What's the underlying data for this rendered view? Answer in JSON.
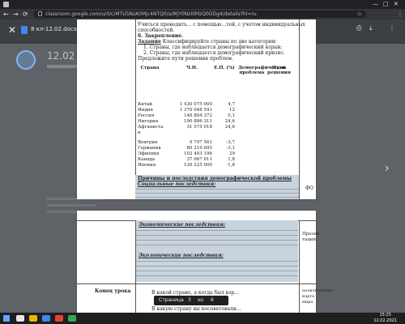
{
  "browser": {
    "tab_glyph": "≡",
    "window_controls": [
      "—",
      "□",
      "✕"
    ],
    "url": "classroom.google.com/u/0/c/MTU5NzA0Mjc4NTQ0/a/MjY0NzI0MzQ0ODg4/details?hl=ru",
    "back": "←",
    "forward": "→",
    "reload": "⟳",
    "star": "☆",
    "menu": "⋮"
  },
  "viewer": {
    "close": "✕",
    "filename": "8 кл-12.02.docx",
    "open_with": "Открыть с помощью...",
    "print": "⎙",
    "download": "⤓",
    "more": "⋮"
  },
  "classroom": {
    "date": "12.02"
  },
  "page1": {
    "lines": [
      {
        "text": "Учиться проводить... с помощью...тей, с учетом индивидуальных",
        "bold": false,
        "ul": false
      },
      {
        "text": "способностей.",
        "bold": false,
        "ul": false
      },
      {
        "text": "6. Закрепление.",
        "bold": true,
        "ul": false
      },
      {
        "text": "Классифицируйте страны по две категории:",
        "bold": false,
        "ul": false,
        "prefix": "Задание"
      },
      {
        "text": "1.   Страны, где наблюдается демографический взрыв;",
        "bold": false,
        "ul": false
      },
      {
        "text": "2.   Страны, где наблюдается демографический кризис.",
        "bold": false,
        "ul": false
      },
      {
        "text": "Предложите пути решения проблем.",
        "bold": false,
        "ul": false
      }
    ],
    "table": {
      "headers": [
        "Страна",
        "Ч.Н.",
        "Е.П. (%)",
        "Демографическая проблема",
        "Пути решения"
      ],
      "rows": [
        {
          "country": "Китай",
          "pop": "1 430 075 000",
          "ep": "4,7"
        },
        {
          "country": "Индия",
          "pop": "1 370 048 541",
          "ep": "12"
        },
        {
          "country": "Россия",
          "pop": "146 804 372",
          "ep": "0,1"
        },
        {
          "country": "Нигерия",
          "pop": "190 886 311",
          "ep": "24,6"
        },
        {
          "country": "Афганиста",
          "pop": "31 575 018",
          "ep": "24,6"
        },
        {
          "country": "н",
          "pop": "",
          "ep": ""
        },
        {
          "country": "",
          "pop": "",
          "ep": ""
        },
        {
          "country": "Венгрия",
          "pop": "9 797 561",
          "ep": "-3,7"
        },
        {
          "country": "Германия",
          "pop": "80 219 695",
          "ep": "-3,1"
        },
        {
          "country": "Эфиопия",
          "pop": "102 403 196",
          "ep": "29"
        },
        {
          "country": "Канада",
          "pop": "37 067 011",
          "ep": "1,8"
        },
        {
          "country": "Япония",
          "pop": "126 225 000",
          "ep": "-1,8"
        }
      ]
    },
    "causes_heading": "Причины и последствия демографической проблемы",
    "social_heading": "Социальные последствия:",
    "fc_label": "ФО"
  },
  "page2": {
    "economic_heading": "Экономические последствия:",
    "ecological_heading": "Экологические последствия:",
    "presentation": "Презен тация",
    "end_label": "Конец урока",
    "end_line1": "В какой стране, а когда был взр...",
    "end_line2": "В какую страну вы посоветовали...",
    "side_text": "политическая карта мира"
  },
  "page_control": {
    "label": "Страница",
    "current": "3",
    "of": "из",
    "total": "6"
  },
  "taskbar": {
    "time": "15:25",
    "date": "12.02.2021"
  },
  "colors": {
    "chrome_dark": "#202124",
    "viewer_bg": "#5f6368",
    "highlight": "#c9d3dd"
  }
}
